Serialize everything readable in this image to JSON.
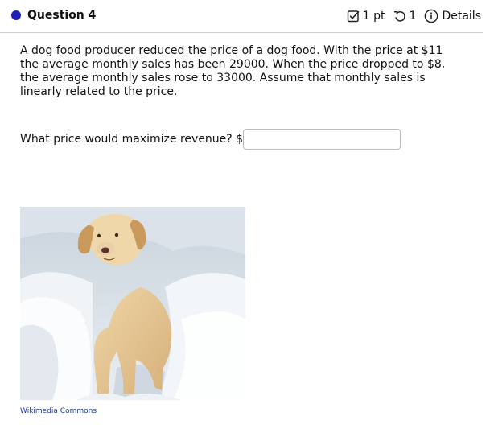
{
  "header": {
    "title": "Question 4",
    "points_label": "1 pt",
    "attempts_value": "1",
    "details_label": "Details"
  },
  "question": {
    "text": "A dog food producer reduced the price of a dog food. With the price at $11 the average monthly sales has been 29000. When the price dropped to $8, the average monthly sales rose to 33000. Assume that monthly sales is linearly related to the price.",
    "prompt": "What price would maximize revenue? $",
    "answer_value": "",
    "answer_placeholder": ""
  },
  "image": {
    "credit": "Wikimedia Commons"
  },
  "icons": {
    "status": "filled-circle-icon",
    "points": "checkbox-icon",
    "attempts": "retry-icon",
    "details": "info-icon"
  },
  "colors": {
    "status_dot": "#1f1fb4",
    "link": "#1d3b8f",
    "divider": "#cfcfcf"
  }
}
